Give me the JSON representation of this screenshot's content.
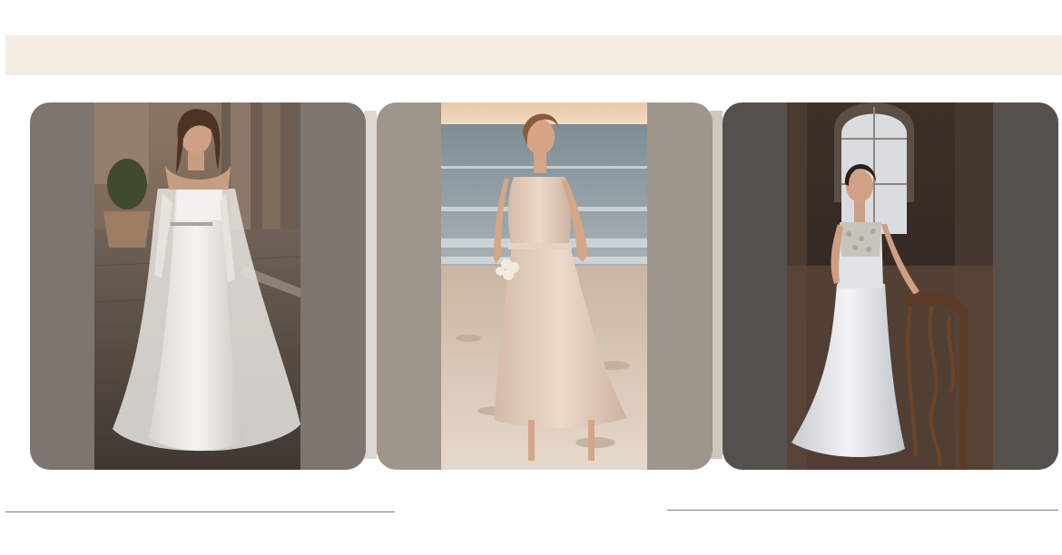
{
  "banner": {
    "color": "#f4ebe1"
  },
  "gallery": {
    "cards": [
      {
        "name": "card-street-wedding-dress",
        "side_color": "#7d7670",
        "photo_subject": "bride-off-shoulder-satin-mermaid-gown-lace-cape-cobblestone-street"
      },
      {
        "name": "card-beach-chiffon-dress",
        "side_color": "#9e958c",
        "photo_subject": "woman-halter-blush-chiffon-midi-dress-beach-bouquet"
      },
      {
        "name": "card-hall-lace-mermaid-dress",
        "side_color": "#55504b",
        "photo_subject": "bride-strapless-lace-bodice-mermaid-gown-staircase-hall"
      }
    ]
  },
  "dividers": {
    "color": "#7a7a7a"
  }
}
